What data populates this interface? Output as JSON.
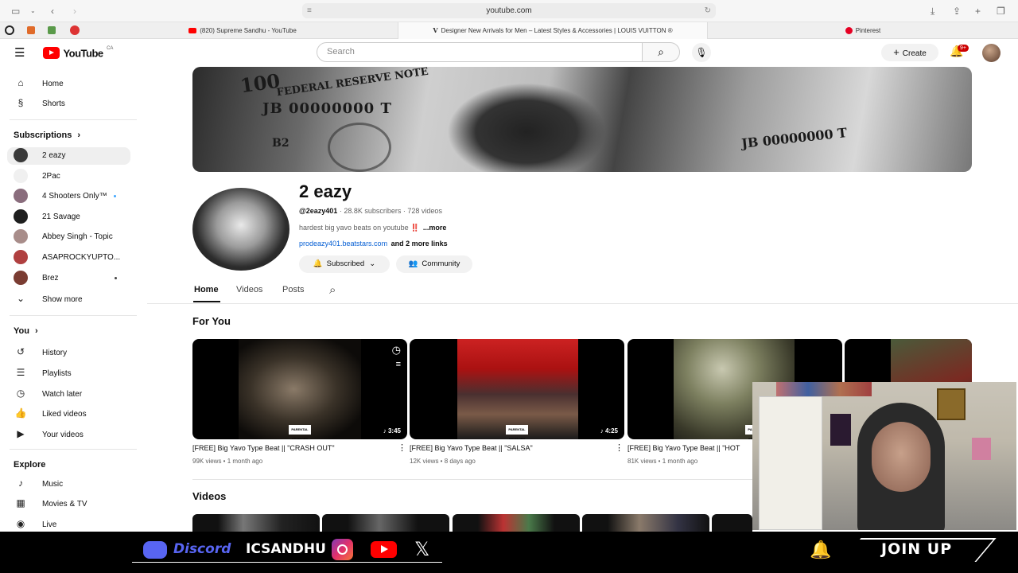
{
  "browser": {
    "url": "youtube.com",
    "tabs": [
      {
        "label": "(820) Supreme Sandhu - YouTube"
      },
      {
        "label": "Designer New Arrivals for Men – Latest Styles & Accessories | LOUIS VUITTON ®"
      },
      {
        "label": "Pinterest"
      }
    ]
  },
  "header": {
    "logo": "YouTube",
    "region": "CA",
    "search_placeholder": "Search",
    "create_label": "Create",
    "notif_badge": "9+"
  },
  "sidebar": {
    "main": [
      {
        "label": "Home",
        "icon": "home-icon"
      },
      {
        "label": "Shorts",
        "icon": "shorts-icon"
      }
    ],
    "subs_heading": "Subscriptions",
    "subs": [
      {
        "label": "2 eazy",
        "color": "#3a3a3a",
        "dot": false
      },
      {
        "label": "2Pac",
        "color": "#f0f0f0",
        "dot": false
      },
      {
        "label": "4 Shooters Only™",
        "color": "#8a6d7d",
        "dot": true
      },
      {
        "label": "21 Savage",
        "color": "#1e1e1e",
        "dot": false
      },
      {
        "label": "Abbey Singh - Topic",
        "color": "#a88d8a",
        "dot": false
      },
      {
        "label": "ASAPROCKYUPTO...",
        "color": "#b04040",
        "dot": false
      },
      {
        "label": "Brez",
        "color": "#7a3c32",
        "dot": true
      }
    ],
    "show_more": "Show more",
    "you_heading": "You",
    "you": [
      {
        "label": "History",
        "icon": "history-icon"
      },
      {
        "label": "Playlists",
        "icon": "playlists-icon"
      },
      {
        "label": "Watch later",
        "icon": "watch-later-icon"
      },
      {
        "label": "Liked videos",
        "icon": "liked-videos-icon"
      },
      {
        "label": "Your videos",
        "icon": "your-videos-icon"
      }
    ],
    "explore_heading": "Explore",
    "explore": [
      {
        "label": "Music",
        "icon": "music-icon"
      },
      {
        "label": "Movies & TV",
        "icon": "movies-icon"
      },
      {
        "label": "Live",
        "icon": "live-icon"
      }
    ]
  },
  "banner": {
    "note_text": "FEDERAL RESERVE NOTE",
    "serial": "JB 00000000 T",
    "serial_right": "JB 00000000 T",
    "denom": "100",
    "b2": "B2"
  },
  "channel": {
    "name": "2 eazy",
    "handle": "@2eazy401",
    "subscribers": "28.8K subscribers",
    "videos": "728 videos",
    "description": "hardest big yavo beats on youtube ‼️",
    "more": "...more",
    "link": "prodeazy401.beatstars.com",
    "more_links": "and 2 more links",
    "subscribed_label": "Subscribed",
    "community_label": "Community"
  },
  "tabs": [
    "Home",
    "Videos",
    "Posts"
  ],
  "for_you_heading": "For You",
  "videos_heading": "Videos",
  "for_you": [
    {
      "title": "[FREE] Big Yavo Type Beat || \"CRASH OUT\"",
      "meta": "99K views • 1 month ago",
      "duration": "3:45"
    },
    {
      "title": "[FREE] Big Yavo Type Beat || \"SALSA\"",
      "meta": "12K views • 8 days ago",
      "duration": "4:25"
    },
    {
      "title": "[FREE] Big Yavo Type Beat || \"HOT",
      "meta": "81K views • 1 month ago",
      "duration": ""
    }
  ],
  "parental_advisory": "PARENTAL ADVISORY EXPLICIT CONTENT",
  "overlay": {
    "discord": "Discord",
    "handle": "ICSANDHU",
    "join": "JOIN UP"
  }
}
